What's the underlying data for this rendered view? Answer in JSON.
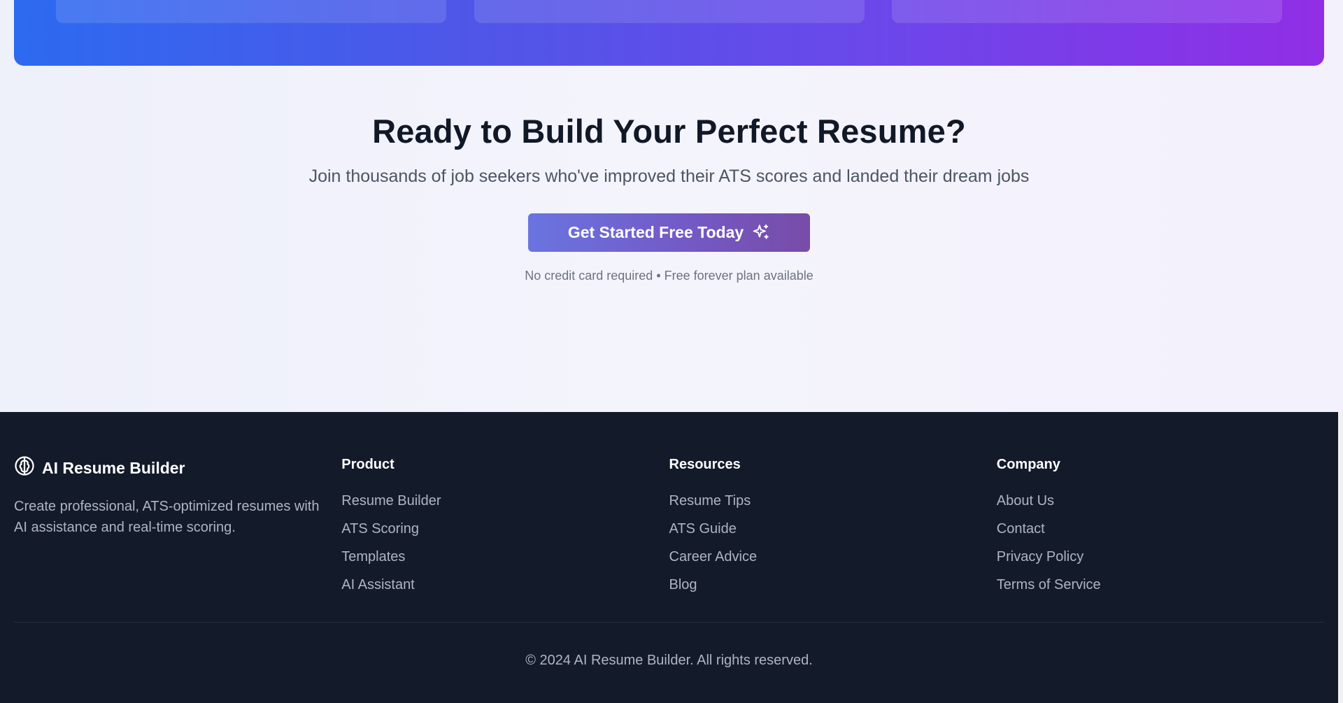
{
  "cta": {
    "title": "Ready to Build Your Perfect Resume?",
    "subtitle": "Join thousands of job seekers who've improved their ATS scores and landed their dream jobs",
    "button_label": "Get Started Free Today",
    "button_icon": "sparkles-icon",
    "note": "No credit card required • Free forever plan available"
  },
  "footer": {
    "brand": {
      "name": "AI Resume Builder",
      "icon": "brain-icon",
      "description": "Create professional, ATS-optimized resumes with AI assistance and real-time scoring."
    },
    "columns": [
      {
        "heading": "Product",
        "links": [
          "Resume Builder",
          "ATS Scoring",
          "Templates",
          "AI Assistant"
        ]
      },
      {
        "heading": "Resources",
        "links": [
          "Resume Tips",
          "ATS Guide",
          "Career Advice",
          "Blog"
        ]
      },
      {
        "heading": "Company",
        "links": [
          "About Us",
          "Contact",
          "Privacy Policy",
          "Terms of Service"
        ]
      }
    ],
    "copyright": "© 2024 AI Resume Builder. All rights reserved."
  },
  "colors": {
    "banner_gradient": [
      "#2c6af0",
      "#902ee6"
    ],
    "button_gradient": [
      "#6a74e0",
      "#784ca8"
    ],
    "footer_bg": "#131a29",
    "heading_text": "#111827"
  }
}
